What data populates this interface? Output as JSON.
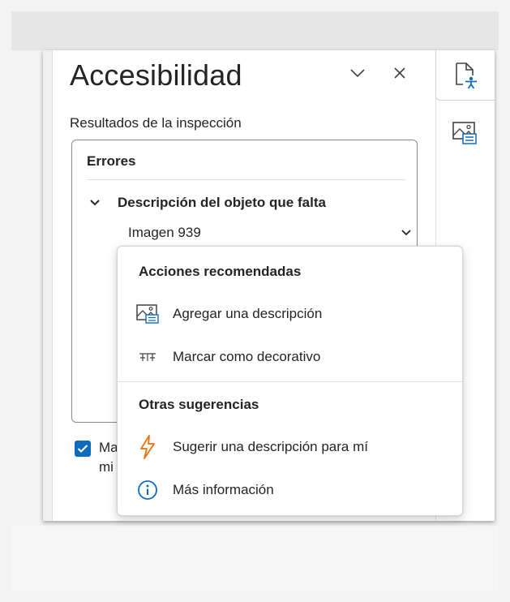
{
  "pane": {
    "title": "Accesibilidad",
    "subtitle": "Resultados de la inspección",
    "errors_header": "Errores",
    "error_category": "Descripción del objeto que falta",
    "error_item": "Imagen 939",
    "checkbox_text": "Ma co mi"
  },
  "menu": {
    "section1": "Acciones recomendadas",
    "add_description": "Agregar una descripción",
    "mark_decorative": "Marcar como decorativo",
    "section2": "Otras sugerencias",
    "suggest_description": "Sugerir una descripción para mí",
    "more_info": "Más información"
  },
  "icons": {
    "collapse": "chevron-down-icon",
    "close": "close-icon",
    "accessibility": "accessibility-icon",
    "alt_text": "alt-text-image-icon",
    "decorative": "decorative-icon",
    "suggest": "lightning-icon",
    "info": "info-icon"
  },
  "colors": {
    "accent": "#0f6cbd",
    "lightning": "#e8700d"
  }
}
